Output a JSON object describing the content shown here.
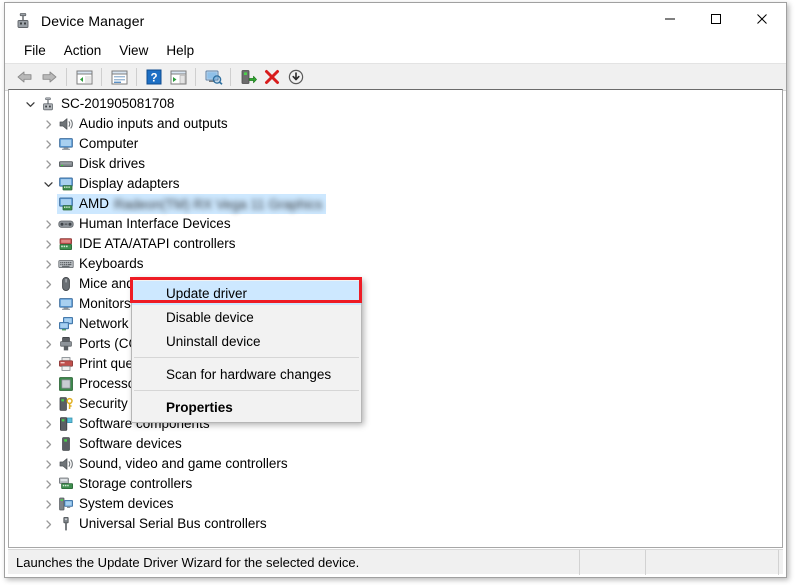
{
  "window": {
    "title": "Device Manager",
    "title_icon": "device-manager-icon",
    "minimize_label": "—",
    "maximize_label": "□",
    "close_label": "✕"
  },
  "menubar": {
    "items": [
      {
        "label": "File"
      },
      {
        "label": "Action"
      },
      {
        "label": "View"
      },
      {
        "label": "Help"
      }
    ]
  },
  "toolbar": {
    "buttons": [
      {
        "name": "back-icon",
        "tip": "Back"
      },
      {
        "name": "forward-icon",
        "tip": "Forward"
      },
      {
        "name": "show-hide-console-tree-icon",
        "tip": "Show/Hide Console Tree"
      },
      {
        "name": "properties-icon",
        "tip": "Properties"
      },
      {
        "name": "help-icon",
        "tip": "Help"
      },
      {
        "name": "show-hide-action-pane-icon",
        "tip": "Show/Hide Action Pane"
      },
      {
        "name": "scan-hardware-changes-icon",
        "tip": "Scan for hardware changes"
      },
      {
        "name": "update-driver-icon",
        "tip": "Update driver"
      },
      {
        "name": "uninstall-device-icon",
        "tip": "Uninstall device"
      },
      {
        "name": "disable-device-icon",
        "tip": "Disable device"
      }
    ]
  },
  "tree": {
    "root": {
      "label": "SC-201905081708",
      "icon": "computer-root-icon",
      "expanded": true
    },
    "nodes": [
      {
        "label": "Audio inputs and outputs",
        "icon": "speaker-icon",
        "expanded": false
      },
      {
        "label": "Computer",
        "icon": "monitor-icon",
        "expanded": false
      },
      {
        "label": "Disk drives",
        "icon": "disk-drive-icon",
        "expanded": false
      },
      {
        "label": "Display adapters",
        "icon": "display-adapter-icon",
        "expanded": true
      },
      {
        "label": "Human Interface Devices",
        "icon": "hid-icon",
        "expanded": false
      },
      {
        "label": "IDE ATA/ATAPI controllers",
        "icon": "ide-controller-icon",
        "expanded": false
      },
      {
        "label": "Keyboards",
        "icon": "keyboard-icon",
        "expanded": false
      },
      {
        "label": "Mice and other pointing devices",
        "icon": "mouse-icon",
        "expanded": false
      },
      {
        "label": "Monitors",
        "icon": "monitor-icon",
        "expanded": false
      },
      {
        "label": "Network adapters",
        "icon": "network-adapter-icon",
        "expanded": false
      },
      {
        "label": "Ports (COM & LPT)",
        "icon": "port-icon",
        "expanded": false
      },
      {
        "label": "Print queues",
        "icon": "printer-icon",
        "expanded": false
      },
      {
        "label": "Processors",
        "icon": "processor-icon",
        "expanded": false
      },
      {
        "label": "Security devices",
        "icon": "security-device-icon",
        "expanded": false
      },
      {
        "label": "Software components",
        "icon": "software-component-icon",
        "expanded": false
      },
      {
        "label": "Software devices",
        "icon": "software-device-icon",
        "expanded": false
      },
      {
        "label": "Sound, video and game controllers",
        "icon": "speaker-icon",
        "expanded": false
      },
      {
        "label": "Storage controllers",
        "icon": "storage-controller-icon",
        "expanded": false
      },
      {
        "label": "System devices",
        "icon": "system-device-icon",
        "expanded": false
      },
      {
        "label": "Universal Serial Bus controllers",
        "icon": "usb-icon",
        "expanded": false
      }
    ],
    "selected_device": {
      "label_visible": "AMD",
      "label_obscured": "Radeon(TM) RX Vega 11 Graphics",
      "icon": "display-adapter-icon",
      "selected": true
    }
  },
  "context_menu": {
    "items": [
      {
        "label": "Update driver",
        "highlighted": true,
        "bold": false
      },
      {
        "label": "Disable device",
        "highlighted": false,
        "bold": false
      },
      {
        "label": "Uninstall device",
        "highlighted": false,
        "bold": false
      },
      {
        "separator": true
      },
      {
        "label": "Scan for hardware changes",
        "highlighted": false,
        "bold": false
      },
      {
        "separator": true
      },
      {
        "label": "Properties",
        "highlighted": false,
        "bold": true
      }
    ]
  },
  "annotation": {
    "highlight_color": "#ee1c25",
    "target": "Update driver"
  },
  "statusbar": {
    "message": "Launches the Update Driver Wizard for the selected device."
  },
  "colors": {
    "selection_blue": "#cde8ff",
    "menu_background": "#f2f2f2",
    "toolbar_background": "#f0f0f0",
    "annotation_red": "#ee1c25"
  }
}
